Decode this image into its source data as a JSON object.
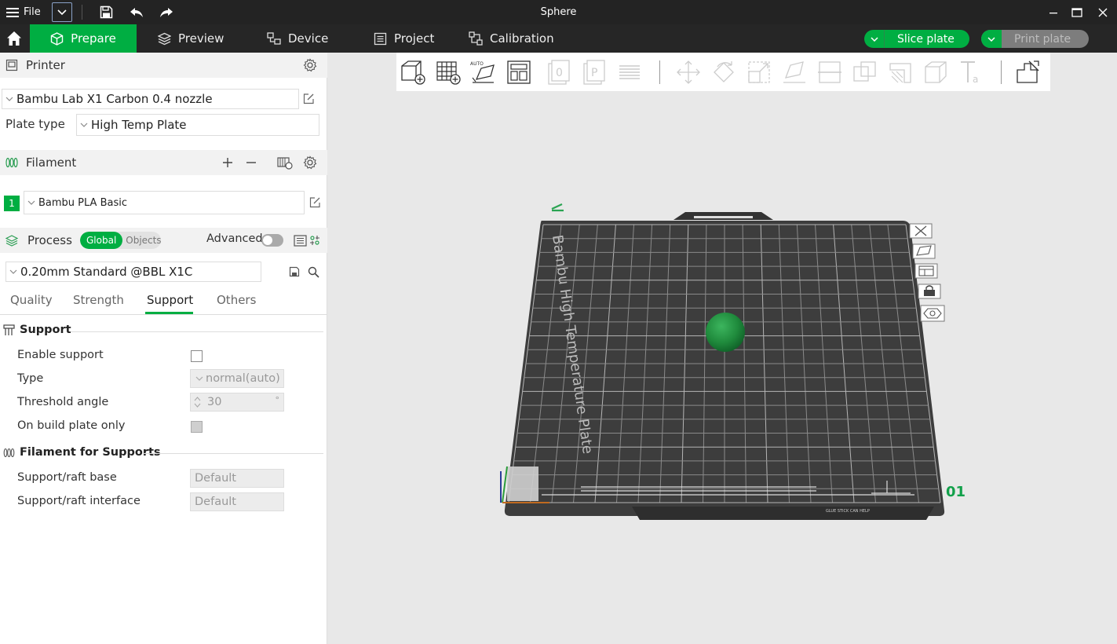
{
  "titlebar": {
    "file_label": "File",
    "window_title": "Sphere"
  },
  "tabs": {
    "prepare": "Prepare",
    "preview": "Preview",
    "device": "Device",
    "project": "Project",
    "calibration": "Calibration",
    "slice_plate": "Slice plate",
    "print_plate": "Print plate"
  },
  "printer": {
    "section_title": "Printer",
    "model": "Bambu Lab X1 Carbon 0.4 nozzle",
    "plate_type_label": "Plate type",
    "plate_type_value": "High Temp Plate"
  },
  "filament": {
    "section_title": "Filament",
    "slot_number": "1",
    "slot_color": "#00ae42",
    "material": "Bambu PLA Basic"
  },
  "process": {
    "section_title": "Process",
    "scope_global": "Global",
    "scope_objects": "Objects",
    "advanced_label": "Advanced",
    "advanced_enabled": false,
    "profile": "0.20mm Standard @BBL X1C",
    "tabs": [
      "Quality",
      "Strength",
      "Support",
      "Others"
    ],
    "active_tab": "Support"
  },
  "support": {
    "group_title": "Support",
    "enable_support_label": "Enable support",
    "enable_support_checked": false,
    "type_label": "Type",
    "type_value": "normal(auto)",
    "threshold_label": "Threshold angle",
    "threshold_value": "30",
    "threshold_unit": "°",
    "build_plate_only_label": "On build plate only",
    "build_plate_only_checked": false
  },
  "filament_for_supports": {
    "group_title": "Filament for Supports",
    "raft_base_label": "Support/raft base",
    "raft_base_value": "Default",
    "raft_interface_label": "Support/raft interface",
    "raft_interface_value": "Default"
  },
  "plate": {
    "label": "Bambu High Temperature Plate",
    "number": "01",
    "footer_right_text": "GLUE STICK CAN HELP",
    "object_color": "#1f8a3c"
  },
  "colors": {
    "accent": "#00ae42",
    "titlebar": "#232323",
    "tabbar": "#262626"
  }
}
